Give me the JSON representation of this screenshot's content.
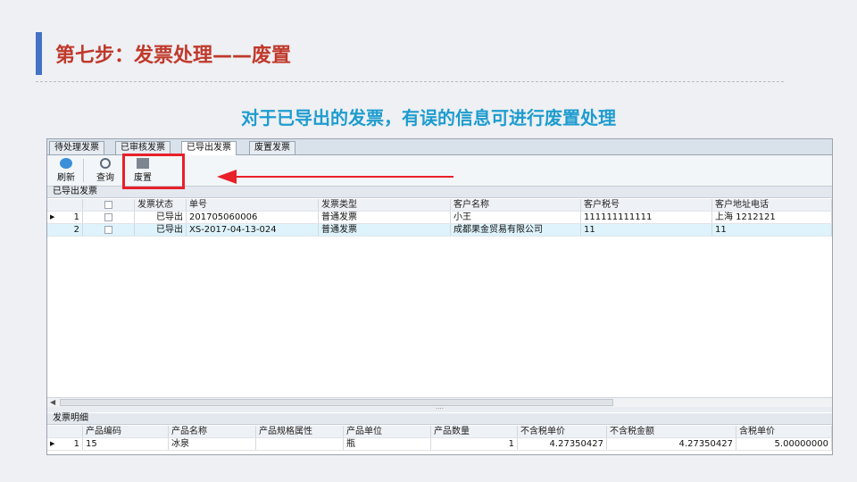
{
  "slide": {
    "title": "第七步：发票处理——废置",
    "subtitle": "对于已导出的发票，有误的信息可进行废置处理"
  },
  "tabs": [
    "待处理发票",
    "已审核发票",
    "已导出发票",
    "废置发票"
  ],
  "active_tab": "已导出发票",
  "toolbar": {
    "refresh": "刷新",
    "query": "查询",
    "void": "废置"
  },
  "invoices": {
    "section_title": "已导出发票",
    "columns": [
      "发票状态",
      "单号",
      "发票类型",
      "客户名称",
      "客户税号",
      "客户地址电话"
    ],
    "rows": [
      {
        "num": "1",
        "status": "已导出",
        "order_no": "201705060006",
        "type": "普通发票",
        "customer": "小王",
        "tax_no": "111111111111",
        "address": "上海  1212121"
      },
      {
        "num": "2",
        "status": "已导出",
        "order_no": "XS-2017-04-13-024",
        "type": "普通发票",
        "customer": "成都果金贸易有限公司",
        "tax_no": "11",
        "address": "11"
      }
    ]
  },
  "details": {
    "section_title": "发票明细",
    "columns": [
      "产品编码",
      "产品名称",
      "产品规格属性",
      "产品单位",
      "产品数量",
      "不含税单价",
      "不含税金额",
      "含税单价"
    ],
    "rows": [
      {
        "num": "1",
        "code": "15",
        "name": "冰泉",
        "spec": "",
        "unit": "瓶",
        "qty": "1",
        "unit_price": "4.27350427",
        "amount": "4.27350427",
        "tax_price": "5.00000000"
      }
    ]
  },
  "colors": {
    "title_red": "#c0392b",
    "subtitle_blue": "#1e9ccf",
    "accent_bar": "#4472c4",
    "highlight_red": "#e8202a"
  }
}
